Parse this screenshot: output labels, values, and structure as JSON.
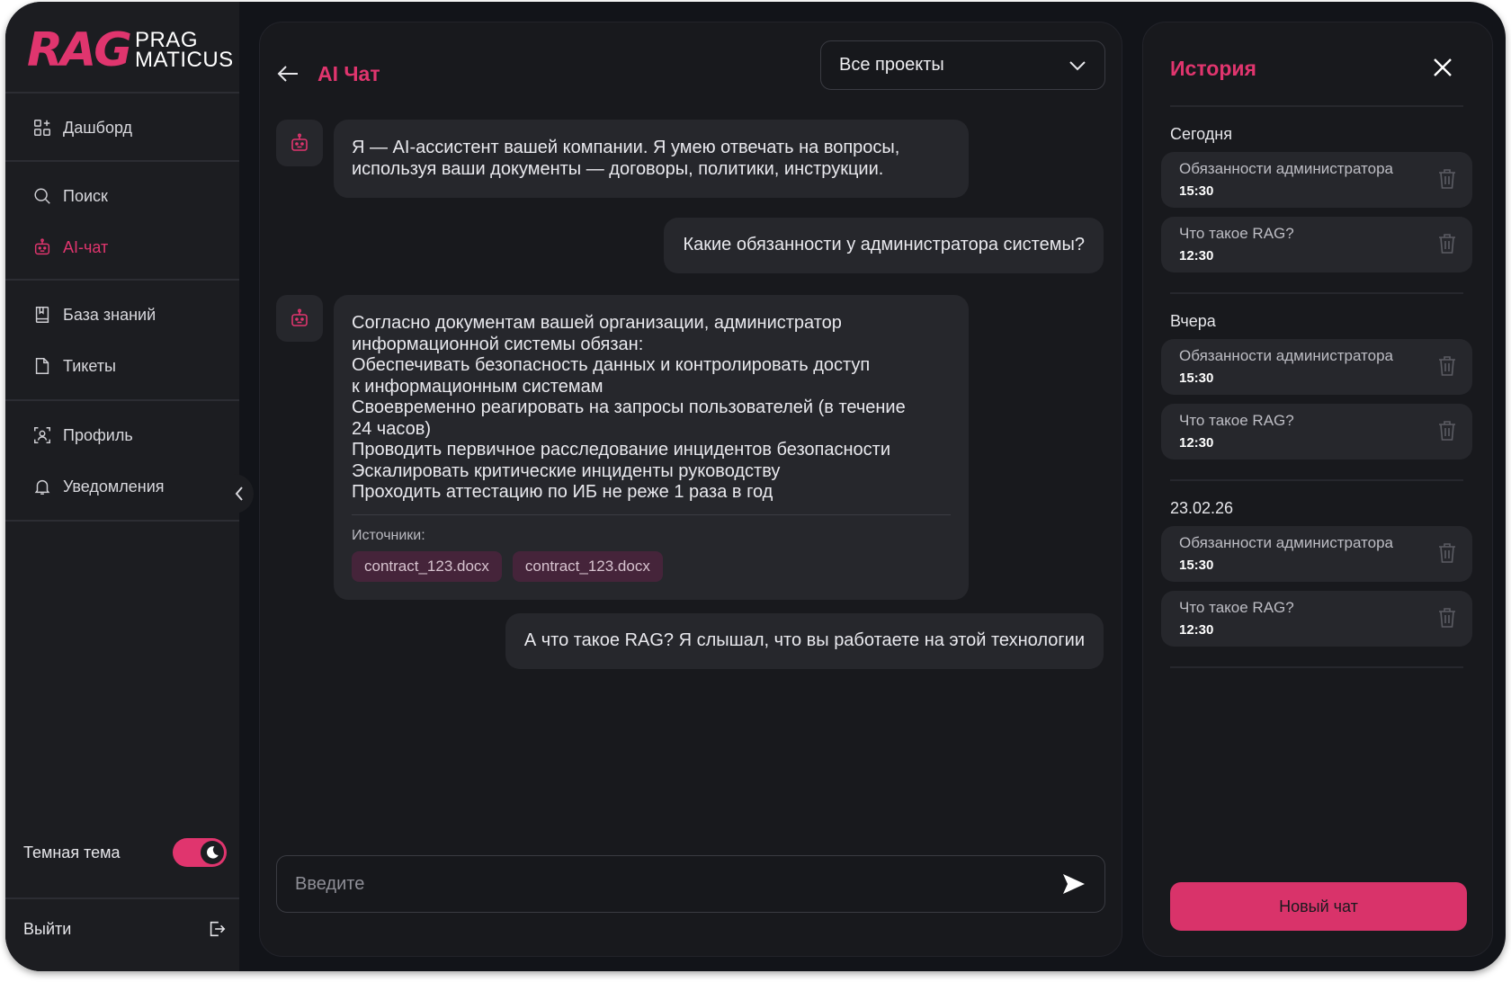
{
  "colors": {
    "accent": "#e0356e",
    "background": "#121419",
    "panel": "#18191d",
    "sidebar": "#1c1d21",
    "bubble": "#26272c"
  },
  "logo": {
    "mark": "RAG",
    "line1": "PRAG",
    "line2": "MATICUS"
  },
  "sidebar": {
    "items": [
      {
        "label": "Дашборд",
        "icon": "dashboard-icon"
      },
      {
        "label": "Поиск",
        "icon": "search-icon"
      },
      {
        "label": "AI-чат",
        "icon": "robot-icon",
        "active": true
      },
      {
        "label": "База знаний",
        "icon": "book-icon"
      },
      {
        "label": "Тикеты",
        "icon": "ticket-icon"
      },
      {
        "label": "Профиль",
        "icon": "profile-icon"
      },
      {
        "label": "Уведомления",
        "icon": "bell-icon"
      }
    ],
    "theme_label": "Темная тема",
    "theme_on": true,
    "logout_label": "Выйти"
  },
  "chat": {
    "title": "AI Чат",
    "project_select": "Все проекты",
    "messages": [
      {
        "role": "bot",
        "lines": [
          "Я — AI-ассистент вашей компании. Я умею отвечать на вопросы,",
          "используя ваши документы — договоры, политики, инструкции."
        ]
      },
      {
        "role": "user",
        "text": "Какие обязанности у администратора системы?"
      },
      {
        "role": "bot",
        "lines": [
          "Согласно документам вашей организации, администратор",
          "информационной системы обязан:",
          "Обеспечивать безопасность данных и контролировать доступ",
          "к информационным системам",
          "Своевременно реагировать на запросы пользователей (в течение",
          "24 часов)",
          "Проводить первичное расследование инцидентов безопасности",
          "Эскалировать критические инциденты руководству",
          "Проходить аттестацию по ИБ не реже 1 раза в год"
        ],
        "sources_label": "Источники:",
        "sources": [
          "contract_123.docx",
          "contract_123.docx"
        ]
      },
      {
        "role": "user",
        "text": "А что такое RAG? Я слышал, что вы работаете на этой технологии"
      }
    ],
    "input_placeholder": "Введите"
  },
  "history": {
    "title": "История",
    "groups": [
      {
        "label": "Сегодня",
        "items": [
          {
            "title": "Обязанности администратора",
            "time": "15:30"
          },
          {
            "title": "Что такое RAG?",
            "time": "12:30"
          }
        ]
      },
      {
        "label": "Вчера",
        "items": [
          {
            "title": "Обязанности администратора",
            "time": "15:30"
          },
          {
            "title": "Что такое RAG?",
            "time": "12:30"
          }
        ]
      },
      {
        "label": "23.02.26",
        "items": [
          {
            "title": "Обязанности администратора",
            "time": "15:30"
          },
          {
            "title": "Что такое RAG?",
            "time": "12:30"
          }
        ]
      }
    ],
    "new_chat_label": "Новый чат"
  }
}
